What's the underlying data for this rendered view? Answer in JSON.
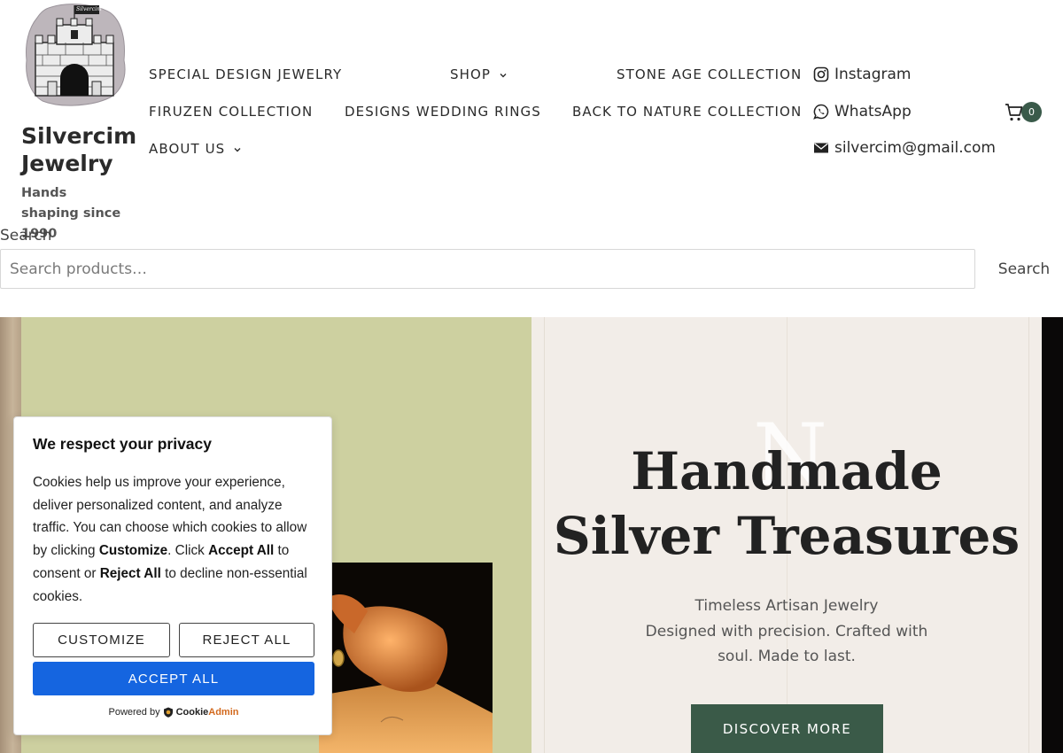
{
  "header": {
    "site_title": "Silvercim Jewelry",
    "tagline": "Hands shaping since 1990",
    "logo_flag_text": "Silvercim",
    "nav": [
      {
        "label": "SPECIAL DESIGN JEWELRY",
        "has_dropdown": false
      },
      {
        "label": "SHOP",
        "has_dropdown": true
      },
      {
        "label": "STONE AGE COLLECTION",
        "has_dropdown": false
      },
      {
        "label": "FIRUZEN COLLECTION",
        "has_dropdown": false
      },
      {
        "label": "DESIGNS WEDDING RINGS",
        "has_dropdown": false
      },
      {
        "label": "BACK TO NATURE COLLECTION",
        "has_dropdown": false
      },
      {
        "label": "ABOUT US",
        "has_dropdown": true
      }
    ],
    "contacts": [
      {
        "icon": "instagram-icon",
        "label": "Instagram"
      },
      {
        "icon": "whatsapp-icon",
        "label": "WhatsApp"
      },
      {
        "icon": "mail-icon",
        "label": "silvercim@gmail.com"
      }
    ],
    "cart_count": "0"
  },
  "search": {
    "label": "Search",
    "placeholder": "Search products…",
    "button_label": "Search"
  },
  "hero": {
    "title_line1": "Handmade",
    "title_line2": "Silver Treasures",
    "subtitle_line1": "Timeless Artisan Jewelry",
    "subtitle_line2": "Designed with precision. Crafted with",
    "subtitle_line3": "soul. Made to last.",
    "ghost_letter": "N",
    "cta_label": "DISCOVER MORE"
  },
  "cookie_banner": {
    "title": "We respect your privacy",
    "text_1": "Cookies help us improve your experience, deliver personalized content, and analyze traffic. You can choose which cookies to allow by clicking ",
    "bold_customize": "Customize",
    "text_2": ". Click ",
    "bold_accept": "Accept All",
    "text_3": " to consent or ",
    "bold_reject": "Reject All",
    "text_4": " to decline non-essential cookies.",
    "customize_label": "CUSTOMIZE",
    "reject_label": "REJECT ALL",
    "accept_label": "ACCEPT ALL",
    "powered_by": "Powered by",
    "brand_part1": "Cookie",
    "brand_part2": "Admin"
  },
  "colors": {
    "accent_green": "#3a5a48",
    "hero_left_bg": "#cdd0a0",
    "hero_right_bg": "#f2ede8",
    "accept_blue": "#1565e0"
  }
}
